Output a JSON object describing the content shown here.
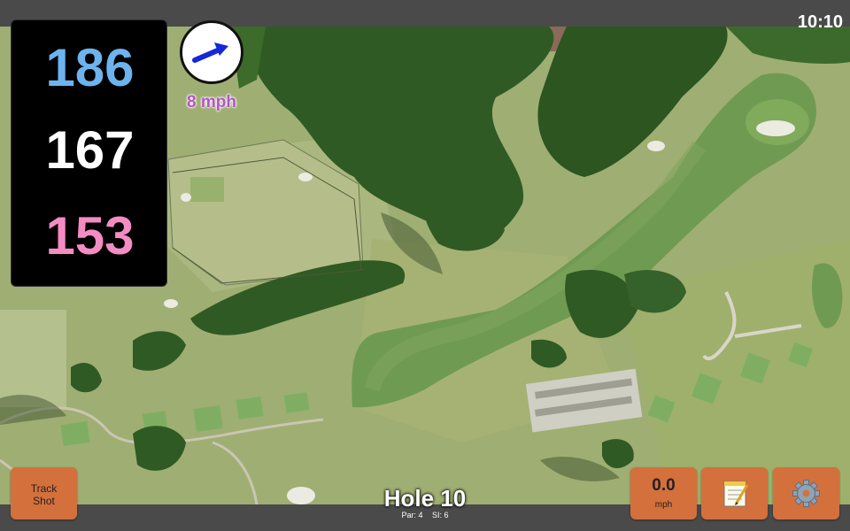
{
  "status_bar": {
    "time": "10:10"
  },
  "distances": {
    "back": "186",
    "middle": "167",
    "front": "153",
    "colors": {
      "back": "#6db3ee",
      "middle": "#ffffff",
      "front": "#f48cc4"
    }
  },
  "wind": {
    "speed_label": "8 mph",
    "icon": "wind-arrow-icon",
    "arrow_color": "#1428d8"
  },
  "hole": {
    "title": "Hole 10",
    "par_label": "Par: 4",
    "si_label": "SI: 6"
  },
  "buttons": {
    "track_shot_line1": "Track",
    "track_shot_line2": "Shot",
    "speed_value": "0.0",
    "speed_unit": "mph",
    "notes_icon": "notepad-icon",
    "settings_icon": "gear-icon"
  },
  "colors": {
    "button": "#d4703b",
    "bar": "#4a4a4a",
    "panel": "#000000"
  }
}
